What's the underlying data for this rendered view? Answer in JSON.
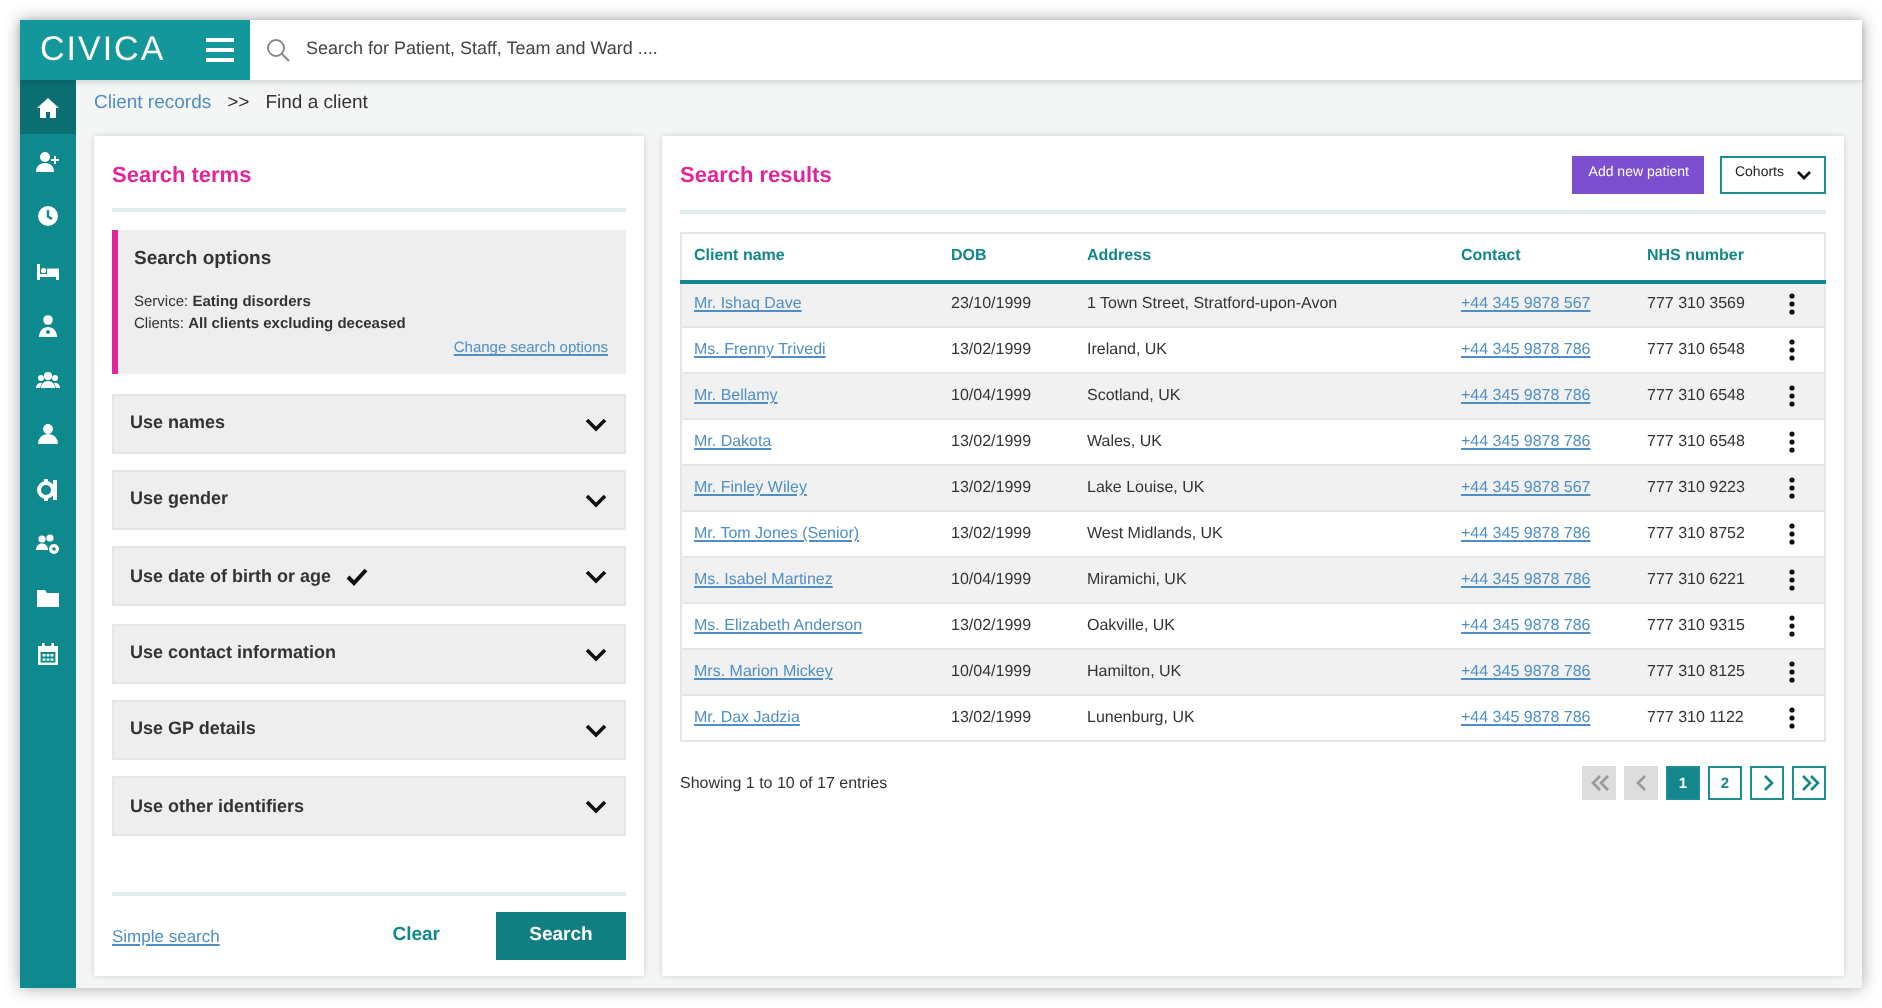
{
  "header": {
    "logo": "CIVICA",
    "search": {
      "placeholder": "Search for Patient, Staff, Team and Ward ...."
    }
  },
  "sidebar": {
    "items": [
      {
        "selected": true
      },
      {
        "selected": false
      },
      {
        "selected": false
      },
      {
        "selected": false
      },
      {
        "selected": false
      },
      {
        "selected": false
      },
      {
        "selected": false
      },
      {
        "selected": false
      },
      {
        "selected": false
      },
      {
        "selected": false
      },
      {
        "selected": false
      }
    ]
  },
  "breadcrumb": {
    "items": [
      "Client records",
      "Find a client"
    ],
    "separator": ">>"
  },
  "search_terms": {
    "title": "Search terms",
    "options": {
      "title": "Search options",
      "lines": [
        {
          "label": "Service:",
          "value": "Eating disorders"
        },
        {
          "label": "Clients:",
          "value": "All clients excluding deceased"
        }
      ],
      "link": "Change search options"
    },
    "sections": [
      {
        "label": "Use names",
        "checked": false
      },
      {
        "label": "Use gender",
        "checked": false
      },
      {
        "label": "Use date of birth or age",
        "checked": true
      },
      {
        "label": "Use contact information",
        "checked": false
      },
      {
        "label": "Use GP details",
        "checked": false
      },
      {
        "label": "Use other identifiers",
        "checked": false
      }
    ],
    "footer": {
      "link": "Simple search",
      "clear": "Clear",
      "search": "Search"
    }
  },
  "search_results": {
    "title": "Search results",
    "add_button": "Add new patient",
    "cohorts_button": "Cohorts",
    "table": {
      "columns": [
        "Client name",
        "DOB",
        "Address",
        "Contact",
        "NHS number"
      ],
      "rows": [
        [
          "Mr. Ishaq Dave",
          "23/10/1999",
          "1 Town Street, Stratford-upon-Avon",
          "+44 345 9878 567",
          "777 310 3569"
        ],
        [
          "Ms. Frenny Trivedi",
          "13/02/1999",
          "Ireland, UK",
          "+44 345 9878 786",
          "777 310 6548"
        ],
        [
          "Mr. Bellamy",
          "10/04/1999",
          "Scotland, UK",
          "+44 345 9878 786",
          "777 310 6548"
        ],
        [
          "Mr. Dakota",
          "13/02/1999",
          "Wales, UK",
          "+44 345 9878 786",
          "777 310 6548"
        ],
        [
          "Mr. Finley Wiley",
          "13/02/1999",
          "Lake Louise, UK",
          "+44 345 9878 567",
          "777 310 9223"
        ],
        [
          "Mr. Tom Jones (Senior)",
          "13/02/1999",
          "West Midlands, UK",
          "+44 345 9878 786",
          "777 310 8752"
        ],
        [
          "Ms. Isabel Martinez",
          "10/04/1999",
          "Miramichi, UK",
          "+44 345 9878 786",
          "777 310 6221"
        ],
        [
          "Ms. Elizabeth Anderson",
          "13/02/1999",
          "Oakville, UK",
          "+44 345 9878 786",
          "777 310 9315"
        ],
        [
          "Mrs. Marion Mickey",
          "10/04/1999",
          "Hamilton, UK",
          "+44 345 9878 786",
          "777 310 8125"
        ],
        [
          "Mr. Dax Jadzia",
          "13/02/1999",
          "Lunenburg, UK",
          "+44 345 9878 786",
          "777 310 1122"
        ]
      ]
    },
    "summary": "Showing 1 to 10 of 17 entries",
    "pagination": [
      {
        "kind": "first",
        "disabled": true,
        "selected": false
      },
      {
        "kind": "prev",
        "disabled": true,
        "selected": false
      },
      {
        "kind": "page",
        "label": "1",
        "disabled": false,
        "selected": true
      },
      {
        "kind": "page",
        "label": "2",
        "disabled": false,
        "selected": false
      },
      {
        "kind": "next",
        "disabled": false,
        "selected": false
      },
      {
        "kind": "last",
        "disabled": false,
        "selected": false
      }
    ]
  }
}
